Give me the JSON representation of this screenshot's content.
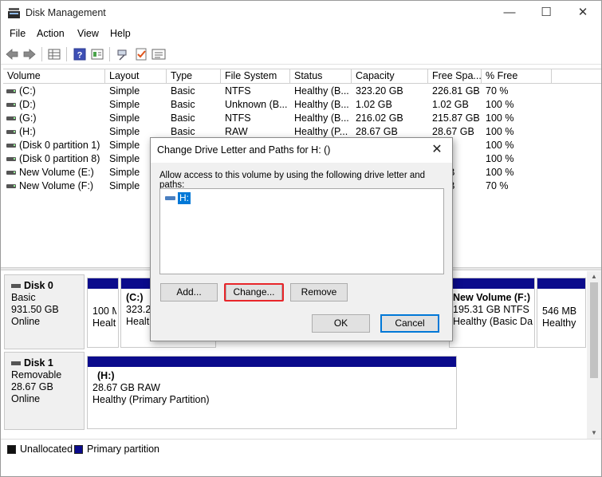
{
  "window": {
    "title": "Disk Management",
    "controls": {
      "minimize": "—",
      "maximize": "☐",
      "close": "✕"
    }
  },
  "menu": [
    "File",
    "Action",
    "View",
    "Help"
  ],
  "toolbar": {
    "icons": [
      "back-arrow-icon",
      "forward-arrow-icon",
      "grid-view-icon",
      "help-icon",
      "properties-icon",
      "rescan-icon",
      "checklist-icon",
      "list-view-icon"
    ]
  },
  "volumes": {
    "columns": [
      "Volume",
      "Layout",
      "Type",
      "File System",
      "Status",
      "Capacity",
      "Free Spa...",
      "% Free"
    ],
    "rows": [
      {
        "volume": "(C:)",
        "layout": "Simple",
        "type": "Basic",
        "fs": "NTFS",
        "status": "Healthy (B...",
        "capacity": "323.20 GB",
        "free": "226.81 GB",
        "pct": "70 %"
      },
      {
        "volume": "(D:)",
        "layout": "Simple",
        "type": "Basic",
        "fs": "Unknown (B...",
        "status": "Healthy (B...",
        "capacity": "1.02 GB",
        "free": "1.02 GB",
        "pct": "100 %"
      },
      {
        "volume": "(G:)",
        "layout": "Simple",
        "type": "Basic",
        "fs": "NTFS",
        "status": "Healthy (B...",
        "capacity": "216.02 GB",
        "free": "215.87 GB",
        "pct": "100 %"
      },
      {
        "volume": "(H:)",
        "layout": "Simple",
        "type": "Basic",
        "fs": "RAW",
        "status": "Healthy (P...",
        "capacity": "28.67 GB",
        "free": "28.67 GB",
        "pct": "100 %"
      },
      {
        "volume": "(Disk 0 partition 1)",
        "layout": "Simple",
        "type": "",
        "fs": "",
        "status": "",
        "capacity": "",
        "free": "MB",
        "pct": "100 %"
      },
      {
        "volume": "(Disk 0 partition 8)",
        "layout": "Simple",
        "type": "",
        "fs": "",
        "status": "",
        "capacity": "",
        "free": "MB",
        "pct": "100 %"
      },
      {
        "volume": "New Volume (E:)",
        "layout": "Simple",
        "type": "",
        "fs": "",
        "status": "",
        "capacity": "",
        "free": "0 GB",
        "pct": "100 %"
      },
      {
        "volume": "New Volume (F:)",
        "layout": "Simple",
        "type": "",
        "fs": "",
        "status": "",
        "capacity": "",
        "free": "3 GB",
        "pct": "70 %"
      }
    ]
  },
  "disks": {
    "disk0": {
      "name": "Disk 0",
      "type": "Basic",
      "size": "931.50 GB",
      "state": "Online",
      "partitions": [
        {
          "line1": "100 M",
          "line2": "Healt"
        },
        {
          "title": "(C:)",
          "line1": "323.20",
          "line2": "Health"
        },
        {
          "title": "New Volume  (F:)",
          "line1": "195.31 GB NTFS",
          "line2": "Healthy (Basic Dat"
        },
        {
          "line1": "546 MB",
          "line2": "Healthy"
        }
      ]
    },
    "disk1": {
      "name": "Disk 1",
      "type": "Removable",
      "size": "28.67 GB",
      "state": "Online",
      "partition": {
        "title": "(H:)",
        "line1": "28.67 GB RAW",
        "line2": "Healthy (Primary Partition)"
      }
    }
  },
  "legend": {
    "unallocated": "Unallocated",
    "primary": "Primary partition",
    "unallocated_color": "#111111",
    "primary_color": "#0b0b8c"
  },
  "dialog": {
    "title": "Change Drive Letter and Paths for H: ()",
    "description": "Allow access to this volume by using the following drive letter and paths:",
    "paths": [
      "H:"
    ],
    "buttons": {
      "add": "Add...",
      "change": "Change...",
      "remove": "Remove",
      "ok": "OK",
      "cancel": "Cancel"
    }
  }
}
